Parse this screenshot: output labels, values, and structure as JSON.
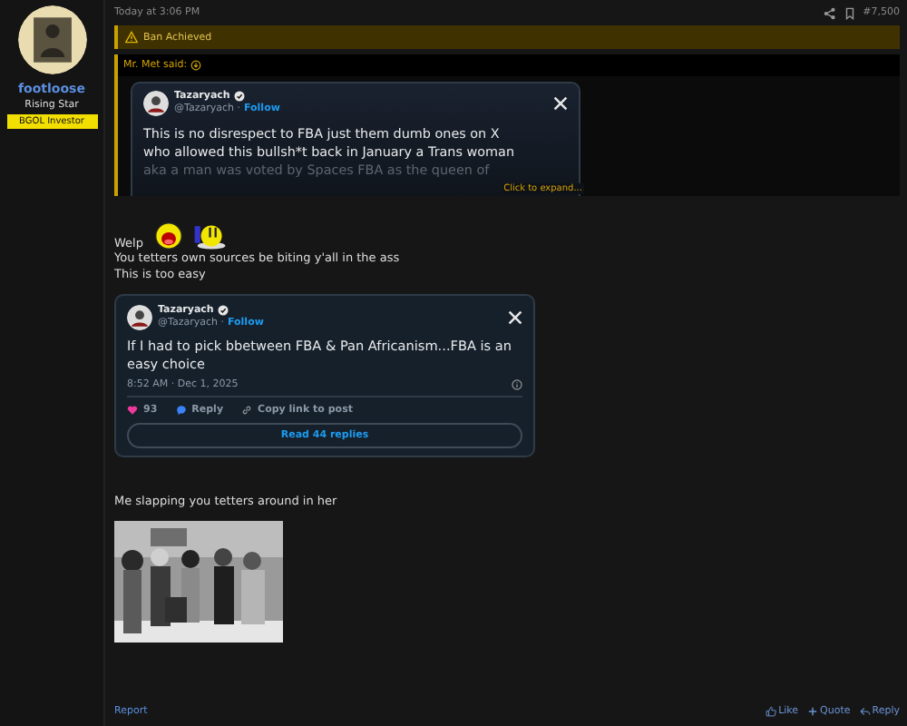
{
  "post": {
    "time": "Today at 3:06 PM",
    "number": "#7,500"
  },
  "user": {
    "name": "footloose",
    "title": "Rising Star",
    "badge": "BGOL Investor"
  },
  "notice": {
    "text": "Ban Achieved"
  },
  "quote": {
    "author": "Mr. Met said:",
    "expand": "Click to expand...",
    "tweet": {
      "name": "Tazaryach",
      "handle": "@Tazaryach ·",
      "follow": "Follow",
      "lines": [
        "This is no disrespect to FBA just them dumb ones on X",
        "who allowed this bullsh*t back in January a Trans woman",
        "aka a man was voted by Spaces FBA as the queen of"
      ]
    }
  },
  "body": {
    "greeting": "Welp",
    "lines": [
      "You tetters own sources be biting y'all in the ass",
      "This is too easy"
    ]
  },
  "tweet": {
    "name": "Tazaryach",
    "handle": "@Tazaryach ·",
    "follow": "Follow",
    "text": "If I had to pick bbetween FBA & Pan Africanism...FBA is an easy choice",
    "timestamp": "8:52 AM · Dec 1, 2025",
    "likes": "93",
    "reply": "Reply",
    "copy": "Copy link to post",
    "read": "Read 44 replies"
  },
  "caption": "Me slapping you tetters around in her",
  "footer": {
    "report": "Report",
    "actions": [
      {
        "kind": "like",
        "label": "Like"
      },
      {
        "kind": "quote",
        "label": "Quote"
      },
      {
        "kind": "reply",
        "label": "Reply"
      }
    ]
  }
}
